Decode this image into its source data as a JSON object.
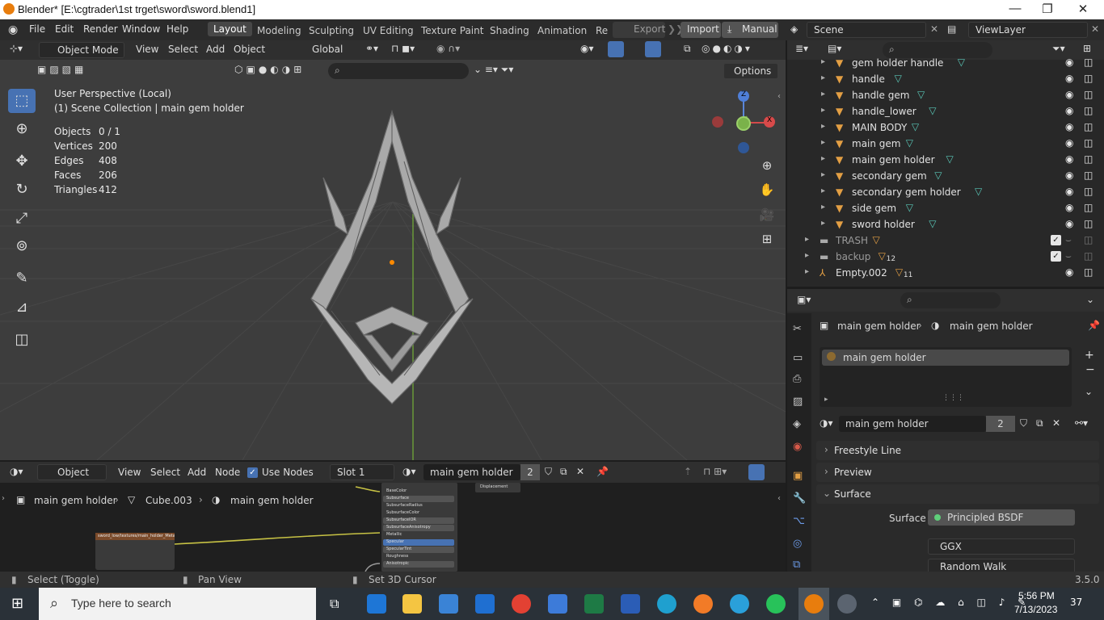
{
  "window": {
    "title": "Blender* [E:\\cgtrader\\1st trget\\sword\\sword.blend1]",
    "minimize": "—",
    "restore": "❐",
    "close": "✕"
  },
  "menus": [
    "File",
    "Edit",
    "Render",
    "Window",
    "Help"
  ],
  "workspaces": [
    "Layout",
    "Modeling",
    "Sculpting",
    "UV Editing",
    "Texture Paint",
    "Shading",
    "Animation",
    "Re"
  ],
  "topbar": {
    "export": "Export",
    "import": "Import",
    "manual": "Manual",
    "scene": "Scene",
    "viewlayer": "ViewLayer"
  },
  "viewport": {
    "mode": "Object Mode",
    "menus": [
      "View",
      "Select",
      "Add",
      "Object"
    ],
    "orientation": "Global",
    "options": "Options",
    "perspective": "User Perspective (Local)",
    "collection": "(1) Scene Collection | main gem holder",
    "stats": [
      {
        "k": "Objects",
        "v": "0 / 1"
      },
      {
        "k": "Vertices",
        "v": "200"
      },
      {
        "k": "Edges",
        "v": "408"
      },
      {
        "k": "Faces",
        "v": "206"
      },
      {
        "k": "Triangles",
        "v": "412"
      }
    ]
  },
  "gizmo": {
    "z": "Z",
    "x": "X"
  },
  "outliner": {
    "items": [
      {
        "name": "gem holder handle"
      },
      {
        "name": "handle"
      },
      {
        "name": "handle gem"
      },
      {
        "name": "handle_lower"
      },
      {
        "name": "MAIN BODY"
      },
      {
        "name": "main gem"
      },
      {
        "name": "main gem holder"
      },
      {
        "name": "secondary gem"
      },
      {
        "name": "secondary gem holder"
      },
      {
        "name": "side gem"
      },
      {
        "name": "sword holder"
      }
    ],
    "collections": [
      {
        "name": "TRASH"
      },
      {
        "name": "backup",
        "badge": "12"
      }
    ],
    "empty": {
      "name": "Empty.002",
      "badge": "11"
    }
  },
  "properties": {
    "breadcrumb": [
      "main gem holder",
      "main gem holder"
    ],
    "slot_item": "main gem holder",
    "material_name": "main gem holder",
    "users": "2",
    "sections": [
      "Freestyle Line",
      "Preview",
      "Surface"
    ],
    "surface_label": "Surface",
    "surface_value": "Principled BSDF",
    "dist": "GGX",
    "sss": "Random Walk"
  },
  "nodeeditor": {
    "type": "Object",
    "menus": [
      "View",
      "Select",
      "Add",
      "Node"
    ],
    "use_nodes": "Use Nodes",
    "slot": "Slot 1",
    "material": "main gem holder",
    "users": "2",
    "breadcrumb": [
      "main gem holder",
      "Cube.003",
      "main gem holder"
    ],
    "node_labels": [
      "BaseColor",
      "Subsurface",
      "SubsurfaceRadius",
      "SubsurfaceColor",
      "SubsurfaceIOR",
      "SubsurfaceAnisotropy",
      "Metallic",
      "Specular",
      "SpecularTint",
      "Roughness",
      "Anisotropic"
    ],
    "displacement": "Displacement",
    "tex_node": "sword_low/textures/main_holder_Metallic.png"
  },
  "statusbar": {
    "left": "Select (Toggle)",
    "mid": "Pan View",
    "right": "Set 3D Cursor",
    "version": "3.5.0"
  },
  "taskbar": {
    "search": "Type here to search",
    "time": "5:56 PM",
    "date": "7/13/2023",
    "notif": "37"
  },
  "colors": {
    "accent": "#4772b3",
    "orange": "#e39f44",
    "teal": "#59c7b7"
  }
}
